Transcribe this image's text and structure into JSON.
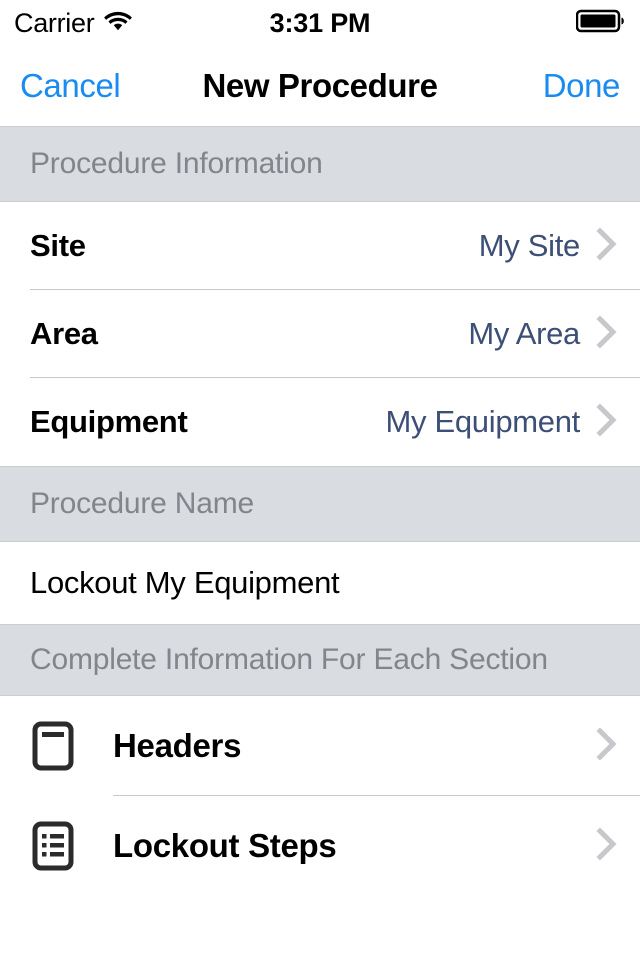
{
  "status_bar": {
    "carrier": "Carrier",
    "wifi_icon": "wifi-icon",
    "time": "3:31 PM",
    "battery_icon": "battery-full-icon"
  },
  "nav_bar": {
    "cancel_label": "Cancel",
    "title": "New Procedure",
    "done_label": "Done",
    "tint_color": "#1a8cf0"
  },
  "sections": {
    "procedure_information": {
      "header": "Procedure Information",
      "rows": [
        {
          "label": "Site",
          "value": "My Site",
          "chevron": "chevron-right-icon"
        },
        {
          "label": "Area",
          "value": "My Area",
          "chevron": "chevron-right-icon"
        },
        {
          "label": "Equipment",
          "value": "My Equipment",
          "chevron": "chevron-right-icon"
        }
      ]
    },
    "procedure_name": {
      "header": "Procedure Name",
      "value": "Lockout My Equipment",
      "placeholder": "Procedure Name"
    },
    "complete_information": {
      "header": "Complete Information For Each Section",
      "rows": [
        {
          "label": "Headers",
          "icon": "document-header-icon",
          "chevron": "chevron-right-icon"
        },
        {
          "label": "Lockout Steps",
          "icon": "list-document-icon",
          "chevron": "chevron-right-icon"
        }
      ]
    }
  },
  "colors": {
    "value_text": "#3d4f76",
    "section_header_bg": "#d9dde2",
    "section_header_text": "#82858a",
    "chevron": "#c7c7cc",
    "separator": "#c8c7cc"
  }
}
